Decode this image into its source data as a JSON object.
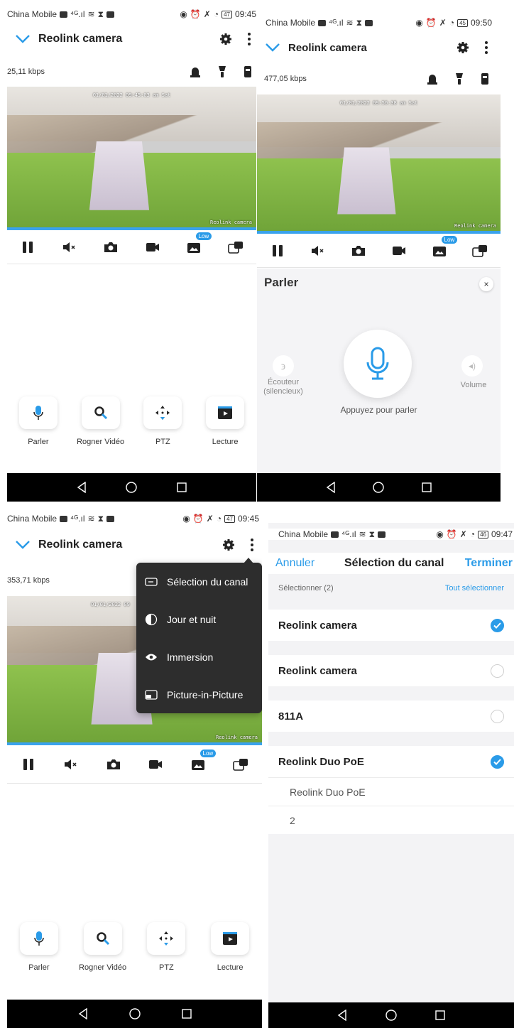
{
  "colors": {
    "accent": "#2a9be8",
    "navbar": "#000000",
    "menu_bg": "#2d2d2d"
  },
  "panels": [
    {
      "status": {
        "carrier": "China Mobile",
        "battery": "47",
        "time": "09:45"
      },
      "title": "Reolink camera",
      "bitrate": "25,11 kbps",
      "video": {
        "timestamp": "01/01/2022 09:45:03 am Sat",
        "watermark": "Reolink camera",
        "progress": 1.0
      },
      "low_badge": "Low",
      "actions": [
        "Parler",
        "Rogner Vidéo",
        "PTZ",
        "Lecture"
      ]
    },
    {
      "status": {
        "carrier": "China Mobile",
        "battery": "45",
        "time": "09:50"
      },
      "title": "Reolink camera",
      "bitrate": "477,05 kbps",
      "video": {
        "timestamp": "01/01/2022 09:50:38 am Sat",
        "watermark": "Reolink camera",
        "progress": 1.0
      },
      "low_badge": "Low",
      "talk": {
        "title": "Parler",
        "close": "×",
        "earpiece": "Écouteur\n(silencieux)",
        "volume": "Volume",
        "hint": "Appuyez pour parler"
      }
    },
    {
      "status": {
        "carrier": "China Mobile",
        "battery": "47",
        "time": "09:45"
      },
      "title": "Reolink camera",
      "bitrate": "353,71 kbps",
      "video": {
        "timestamp": "01/01/2022 09",
        "watermark": "Reolink camera",
        "progress": 1.0
      },
      "low_badge": "Low",
      "menu": [
        "Sélection du canal",
        "Jour et nuit",
        "Immersion",
        "Picture-in-Picture"
      ],
      "actions": [
        "Parler",
        "Rogner Vidéo",
        "PTZ",
        "Lecture"
      ]
    },
    {
      "status": {
        "carrier": "China Mobile",
        "battery": "46",
        "time": "09:47"
      },
      "cancel": "Annuler",
      "title": "Sélection du canal",
      "done": "Terminer",
      "selected": "Sélectionner (2)",
      "select_all": "Tout sélectionner",
      "channels": [
        {
          "name": "Reolink camera",
          "checked": true
        },
        {
          "name": "Reolink camera",
          "checked": false
        },
        {
          "name": "811A",
          "checked": false
        },
        {
          "name": "Reolink Duo PoE",
          "checked": true
        }
      ],
      "sub_channels": [
        "Reolink Duo PoE",
        "2"
      ]
    }
  ]
}
